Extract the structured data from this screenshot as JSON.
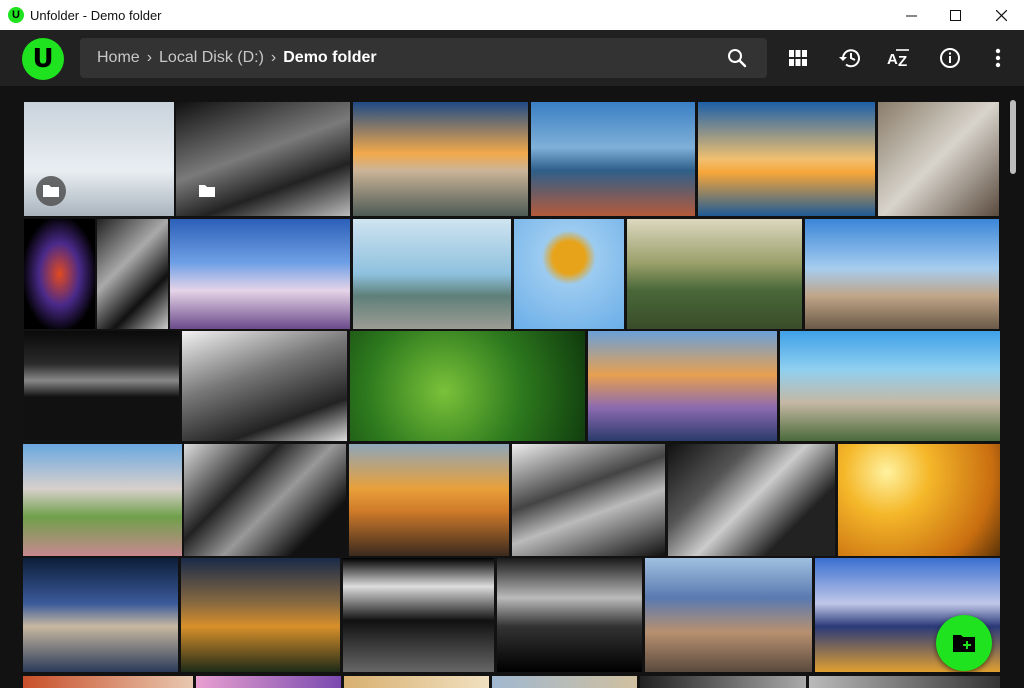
{
  "window": {
    "title": "Unfolder - Demo folder",
    "logo_letter": "U",
    "minimize": "—",
    "maximize": "☐",
    "close": "✕"
  },
  "app": {
    "logo_letter": "U",
    "accent": "#1ee31e"
  },
  "breadcrumb": {
    "items": [
      "Home",
      "Local Disk (D:)",
      "Demo folder"
    ],
    "separator": "›"
  },
  "toolbar": {
    "icons": [
      "grid-view-icon",
      "history-icon",
      "sort-az-icon",
      "info-icon",
      "more-vert-icon"
    ],
    "sort_label": "AZ"
  },
  "gallery": {
    "tile_count": 37,
    "folder_tiles": 2
  },
  "fab": {
    "icon": "create-folder-icon"
  }
}
